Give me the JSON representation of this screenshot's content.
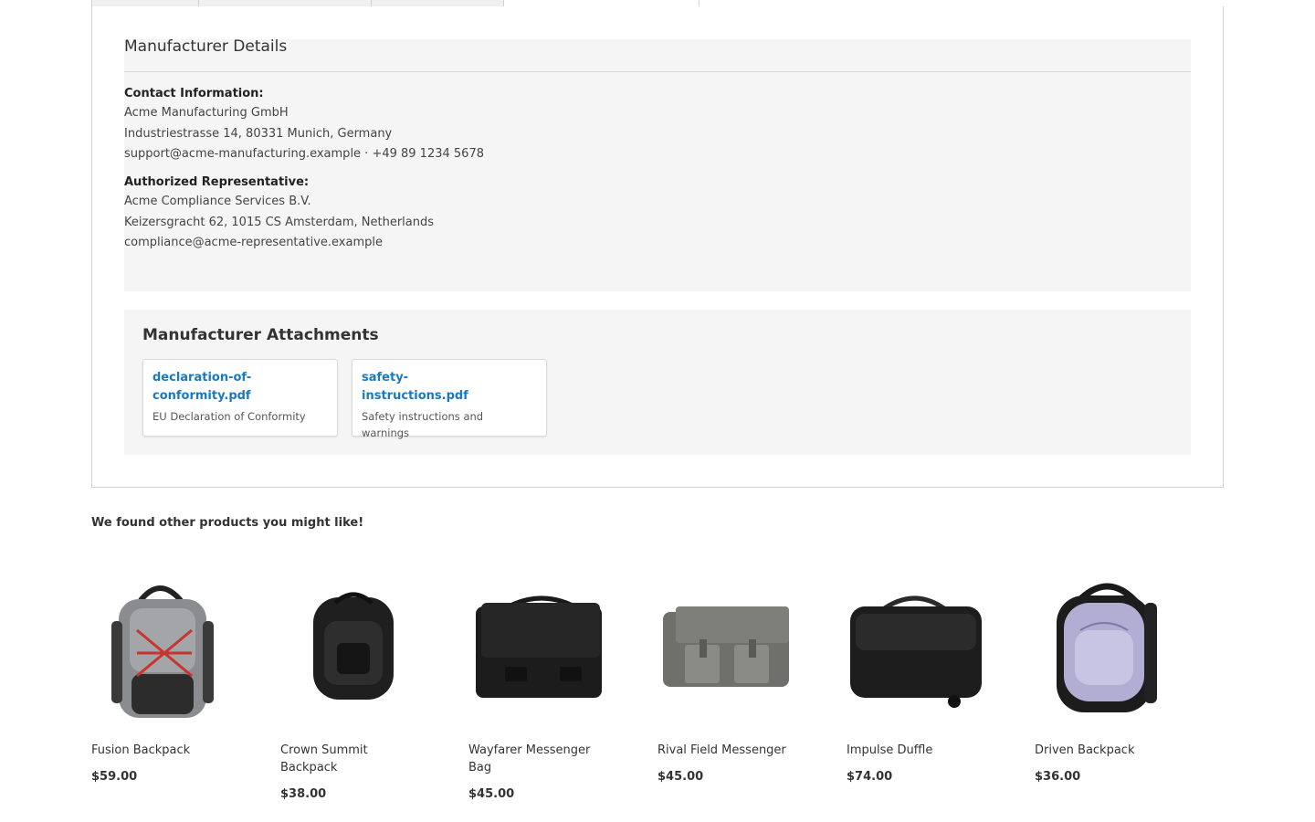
{
  "manufacturer": {
    "title": "Manufacturer Details",
    "contact": {
      "label": "Contact Information:",
      "company": "Acme Manufacturing GmbH",
      "address": "Industriestrasse 14, 80331 Munich, Germany",
      "contact_line": "support@acme-manufacturing.example · +49 89 1234 5678"
    },
    "representative": {
      "label": "Authorized Representative:",
      "company": "Acme Compliance Services B.V.",
      "address": "Keizersgracht 62, 1015 CS Amsterdam, Netherlands",
      "email": "compliance@acme-representative.example"
    }
  },
  "attachments": {
    "title": "Manufacturer Attachments",
    "items": [
      {
        "file": "declaration-of-conformity.pdf",
        "description": "EU Declaration of Conformity"
      },
      {
        "file": "safety-instructions.pdf",
        "description": "Safety instructions and warnings"
      }
    ]
  },
  "related": {
    "title": "We found other products you might like!",
    "products": [
      {
        "name": "Fusion Backpack",
        "price": "$59.00"
      },
      {
        "name": "Crown Summit Backpack",
        "price": "$38.00"
      },
      {
        "name": "Wayfarer Messenger Bag",
        "price": "$45.00"
      },
      {
        "name": "Rival Field Messenger",
        "price": "$45.00"
      },
      {
        "name": "Impulse Duffle",
        "price": "$74.00"
      },
      {
        "name": "Driven Backpack",
        "price": "$36.00"
      }
    ]
  },
  "colors": {
    "link": "#1979c3",
    "panel_bg": "#f5f5f5",
    "border": "#d1d1d1"
  }
}
